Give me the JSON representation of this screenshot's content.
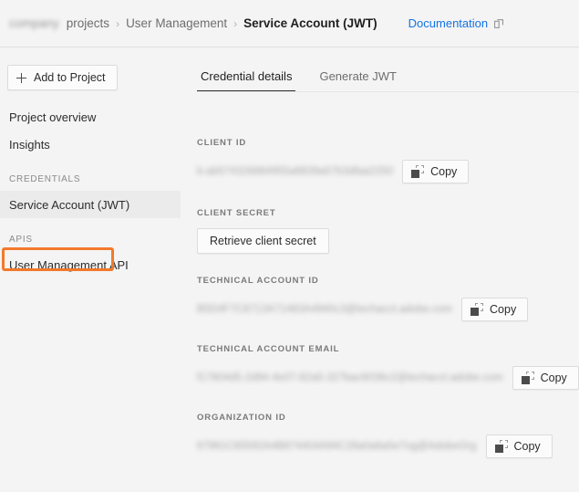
{
  "header": {
    "breadcrumb": [
      {
        "label": "company",
        "redacted": true,
        "current": false
      },
      {
        "label": "projects",
        "redacted": false,
        "current": false
      },
      {
        "label": "User Management",
        "redacted": false,
        "current": false
      },
      {
        "label": "Service Account (JWT)",
        "redacted": false,
        "current": true
      }
    ],
    "separator": "›",
    "documentation_label": "Documentation",
    "documentation_icon": "external-link-icon"
  },
  "sidebar": {
    "add_button": {
      "label": "Add to Project",
      "icon": "plus-icon"
    },
    "items": [
      {
        "label": "Project overview",
        "type": "item",
        "selected": false
      },
      {
        "label": "Insights",
        "type": "item",
        "selected": false
      },
      {
        "label": "CREDENTIALS",
        "type": "group",
        "selected": false
      },
      {
        "label": "Service Account (JWT)",
        "type": "item",
        "selected": true
      },
      {
        "label": "APIS",
        "type": "group",
        "selected": false
      },
      {
        "label": "User Management API",
        "type": "item",
        "selected": false
      }
    ],
    "annotation_color": "#f2792b",
    "selected_bg": "#ebebeb"
  },
  "main": {
    "tabs": [
      {
        "label": "Credential details",
        "active": true
      },
      {
        "label": "Generate JWT",
        "active": false
      }
    ],
    "fields": [
      {
        "label": "CLIENT ID",
        "value": "b-ab574326884955a8839a57b3dfaa2250",
        "masked": true,
        "action": {
          "type": "copy",
          "label": "Copy",
          "icon": "copy-icon"
        }
      },
      {
        "label": "CLIENT SECRET",
        "value": "",
        "masked": false,
        "action": {
          "type": "button",
          "label": "Retrieve client secret",
          "icon": ""
        }
      },
      {
        "label": "TECHNICAL ACCOUNT ID",
        "value": "B5D4F7C6713A71483A4940c3@techacct.adobe.com",
        "masked": true,
        "action": {
          "type": "copy",
          "label": "Copy",
          "icon": "copy-icon"
        }
      },
      {
        "label": "TECHNICAL ACCOUNT EMAIL",
        "value": "f17804d5-2d94-4e07-82a5-327bac6036c2@techacct.adobe.com",
        "masked": true,
        "action": {
          "type": "copy",
          "label": "Copy",
          "icon": "copy-icon"
        }
      },
      {
        "label": "ORGANIZATION ID",
        "value": "67961C65592A4B874404A94C28a0a6a5e7og@AdobeOrg",
        "masked": true,
        "action": {
          "type": "copy",
          "label": "Copy",
          "icon": "copy-icon"
        }
      }
    ]
  },
  "colors": {
    "background": "#f4f4f4",
    "link": "#1473e6",
    "annotation": "#f2792b",
    "text": "#2c2c2c",
    "muted": "#7a7a7a"
  }
}
